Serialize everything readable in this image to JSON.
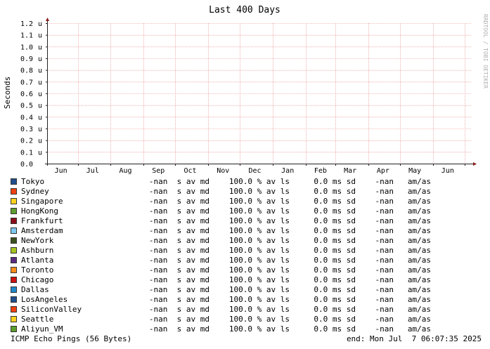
{
  "chart_data": {
    "type": "line",
    "title": "Last 400 Days",
    "ylabel": "Seconds",
    "xlabel": "",
    "watermark": "RRDTOOL / TOBI OETIKER",
    "y_ticks": [
      "0.0",
      "0.1 u",
      "0.2 u",
      "0.3 u",
      "0.4 u",
      "0.5 u",
      "0.6 u",
      "0.7 u",
      "0.8 u",
      "0.9 u",
      "1.0 u",
      "1.1 u",
      "1.2 u"
    ],
    "y_tick_values": [
      0,
      0.1,
      0.2,
      0.3,
      0.4,
      0.5,
      0.6,
      0.7,
      0.8,
      0.9,
      1.0,
      1.1,
      1.2
    ],
    "ylim": [
      0,
      1.2
    ],
    "x_ticks": [
      "Jun",
      "Jul",
      "Aug",
      "Sep",
      "Oct",
      "Nov",
      "Dec",
      "Jan",
      "Feb",
      "Mar",
      "Apr",
      "May",
      "Jun"
    ],
    "x_tick_dates": [
      "2024-06-15",
      "2024-07-15",
      "2024-08-15",
      "2024-09-15",
      "2024-10-15",
      "2024-11-15",
      "2024-12-15",
      "2025-01-15",
      "2025-02-15",
      "2025-03-15",
      "2025-04-15",
      "2025-05-15",
      "2025-06-15"
    ],
    "x_gridline_dates": [
      "2024-06-01",
      "2024-07-01",
      "2024-08-01",
      "2024-09-01",
      "2024-10-01",
      "2024-11-01",
      "2024-12-01",
      "2025-01-01",
      "2025-02-01",
      "2025-03-01",
      "2025-04-01",
      "2025-05-01",
      "2025-06-01",
      "2025-07-01"
    ],
    "xlim": [
      "2024-06-02",
      "2025-07-07"
    ],
    "grid": true,
    "legend_position": "bottom",
    "series": [
      {
        "name": "Tokyo",
        "color": "#1f4e8c",
        "avg": "-nan  s av md",
        "loss": "100.0 % av ls",
        "sd": "0.0 ms sd",
        "amas": "-nan   am/as",
        "values": []
      },
      {
        "name": "Sydney",
        "color": "#f04010",
        "avg": "-nan  s av md",
        "loss": "100.0 % av ls",
        "sd": "0.0 ms sd",
        "amas": "-nan   am/as",
        "values": []
      },
      {
        "name": "Singapore",
        "color": "#ffd21f",
        "avg": "-nan  s av md",
        "loss": "100.0 % av ls",
        "sd": "0.0 ms sd",
        "amas": "-nan   am/as",
        "values": []
      },
      {
        "name": "HongKong",
        "color": "#5c9e2e",
        "avg": "-nan  s av md",
        "loss": "100.0 % av ls",
        "sd": "0.0 ms sd",
        "amas": "-nan   am/as",
        "values": []
      },
      {
        "name": "Frankfurt",
        "color": "#8b0e1a",
        "avg": "-nan  s av md",
        "loss": "100.0 % av ls",
        "sd": "0.0 ms sd",
        "amas": "-nan   am/as",
        "values": []
      },
      {
        "name": "Amsterdam",
        "color": "#7ec8f0",
        "avg": "-nan  s av md",
        "loss": "100.0 % av ls",
        "sd": "0.0 ms sd",
        "amas": "-nan   am/as",
        "values": []
      },
      {
        "name": "NewYork",
        "color": "#3a4f1c",
        "avg": "-nan  s av md",
        "loss": "100.0 % av ls",
        "sd": "0.0 ms sd",
        "amas": "-nan   am/as",
        "values": []
      },
      {
        "name": "Ashburn",
        "color": "#a6c41e",
        "avg": "-nan  s av md",
        "loss": "100.0 % av ls",
        "sd": "0.0 ms sd",
        "amas": "-nan   am/as",
        "values": []
      },
      {
        "name": "Atlanta",
        "color": "#5a2a82",
        "avg": "-nan  s av md",
        "loss": "100.0 % av ls",
        "sd": "0.0 ms sd",
        "amas": "-nan   am/as",
        "values": []
      },
      {
        "name": "Toronto",
        "color": "#ff8c1a",
        "avg": "-nan  s av md",
        "loss": "100.0 % av ls",
        "sd": "0.0 ms sd",
        "amas": "-nan   am/as",
        "values": []
      },
      {
        "name": "Chicago",
        "color": "#cc1111",
        "avg": "-nan  s av md",
        "loss": "100.0 % av ls",
        "sd": "0.0 ms sd",
        "amas": "-nan   am/as",
        "values": []
      },
      {
        "name": "Dallas",
        "color": "#1e88c8",
        "avg": "-nan  s av md",
        "loss": "100.0 % av ls",
        "sd": "0.0 ms sd",
        "amas": "-nan   am/as",
        "values": []
      },
      {
        "name": "LosAngeles",
        "color": "#1f4e8c",
        "avg": "-nan  s av md",
        "loss": "100.0 % av ls",
        "sd": "0.0 ms sd",
        "amas": "-nan   am/as",
        "values": []
      },
      {
        "name": "SiliconValley",
        "color": "#f04010",
        "avg": "-nan  s av md",
        "loss": "100.0 % av ls",
        "sd": "0.0 ms sd",
        "amas": "-nan   am/as",
        "values": []
      },
      {
        "name": "Seattle",
        "color": "#ffd21f",
        "avg": "-nan  s av md",
        "loss": "100.0 % av ls",
        "sd": "0.0 ms sd",
        "amas": "-nan   am/as",
        "values": []
      },
      {
        "name": "Aliyun_VM",
        "color": "#5c9e2e",
        "avg": "-nan  s av md",
        "loss": "100.0 % av ls",
        "sd": "0.0 ms sd",
        "amas": "-nan   am/as",
        "values": []
      }
    ]
  },
  "footer": {
    "left": "ICMP Echo Pings (56 Bytes)",
    "right": "end: Mon Jul  7 06:07:35 2025"
  },
  "colors": {
    "grid_major": "#e88080",
    "grid_minor": "#f0b0b0",
    "axis": "#222222",
    "arrow": "#8b1a1a"
  }
}
